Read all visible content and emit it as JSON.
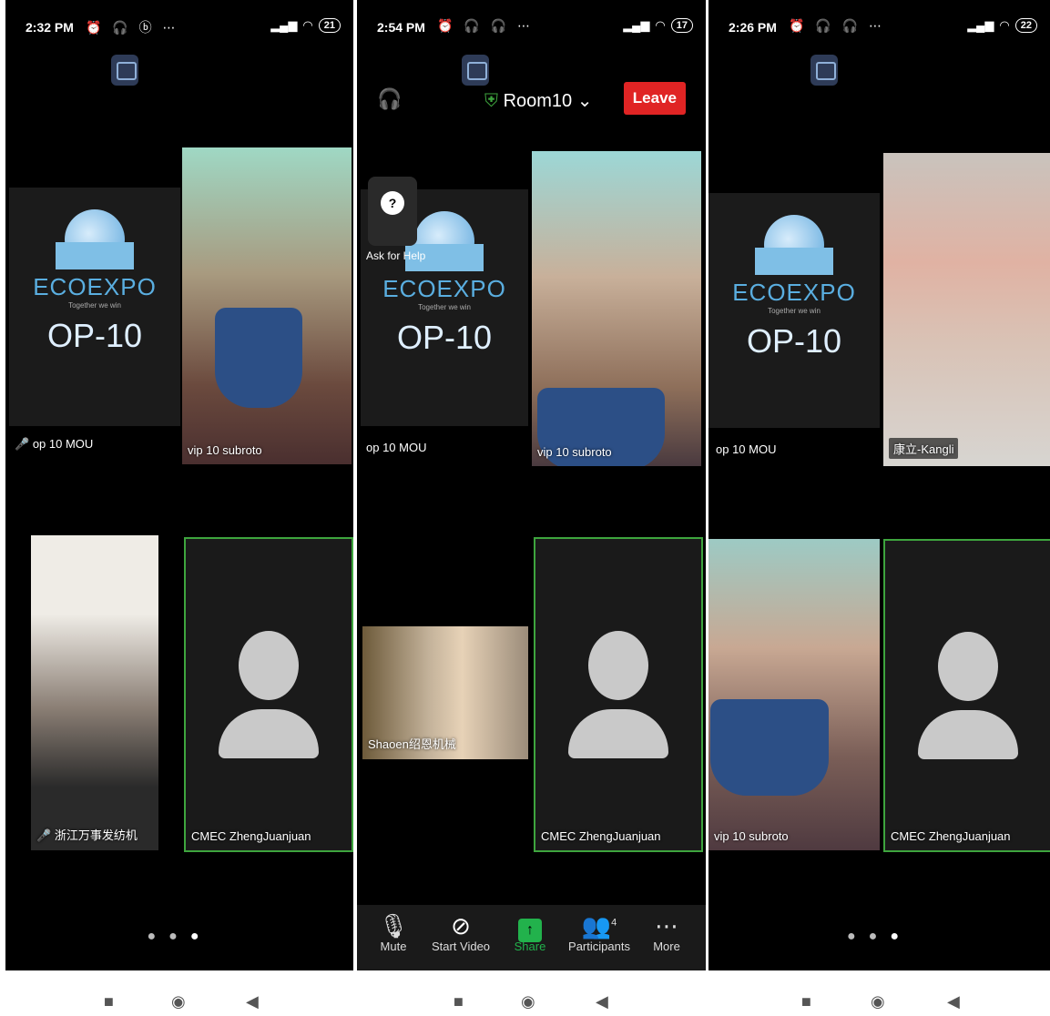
{
  "panels": [
    {
      "status": {
        "time": "2:32 PM",
        "icons": "⏰ 🎧 ⓑ ⋯",
        "battery": "21"
      },
      "tiles": {
        "logo_tile": {
          "brand": "ECOEXPO",
          "tagline": "Together we win",
          "room": "OP-10",
          "name": "op 10 MOU"
        },
        "video_tr": {
          "name": "vip 10 subroto"
        },
        "video_bl": {
          "name": "浙江万事发纺机"
        },
        "avatar_br": {
          "name": "CMEC ZhengJuanjuan"
        }
      }
    },
    {
      "status": {
        "time": "2:54 PM",
        "icons": "⏰ 🎧 🎧 ⋯",
        "battery": "17"
      },
      "room": "Room10",
      "leave": "Leave",
      "help": "Ask for Help",
      "tiles": {
        "logo_tile": {
          "brand": "ECOEXPO",
          "tagline": "Together we win",
          "room": "OP-10",
          "name": "op 10 MOU"
        },
        "video_tr": {
          "name": "vip 10 subroto"
        },
        "video_ml": {
          "name": "Shaoen绍恩机械"
        },
        "avatar_br": {
          "name": "CMEC ZhengJuanjuan"
        }
      },
      "toolbar": [
        {
          "label": "Mute",
          "icon": "mic-icon"
        },
        {
          "label": "Start Video",
          "icon": "video-off-icon"
        },
        {
          "label": "Share",
          "icon": "share-icon"
        },
        {
          "label": "Participants",
          "icon": "participants-icon",
          "count": "4"
        },
        {
          "label": "More",
          "icon": "more-icon"
        }
      ]
    },
    {
      "status": {
        "time": "2:26 PM",
        "icons": "⏰ 🎧 🎧 ⋯",
        "battery": "22"
      },
      "tiles": {
        "logo_tile": {
          "brand": "ECOEXPO",
          "tagline": "Together we win",
          "room": "OP-10",
          "name": "op 10 MOU"
        },
        "video_tr": {
          "name": "康立-Kangli"
        },
        "video_bl": {
          "name": "vip 10 subroto"
        },
        "avatar_br": {
          "name": "CMEC ZhengJuanjuan"
        }
      }
    }
  ],
  "colors": {
    "accent_green": "#3ea53e",
    "leave_red": "#e02424",
    "share_green": "#22b24c"
  }
}
